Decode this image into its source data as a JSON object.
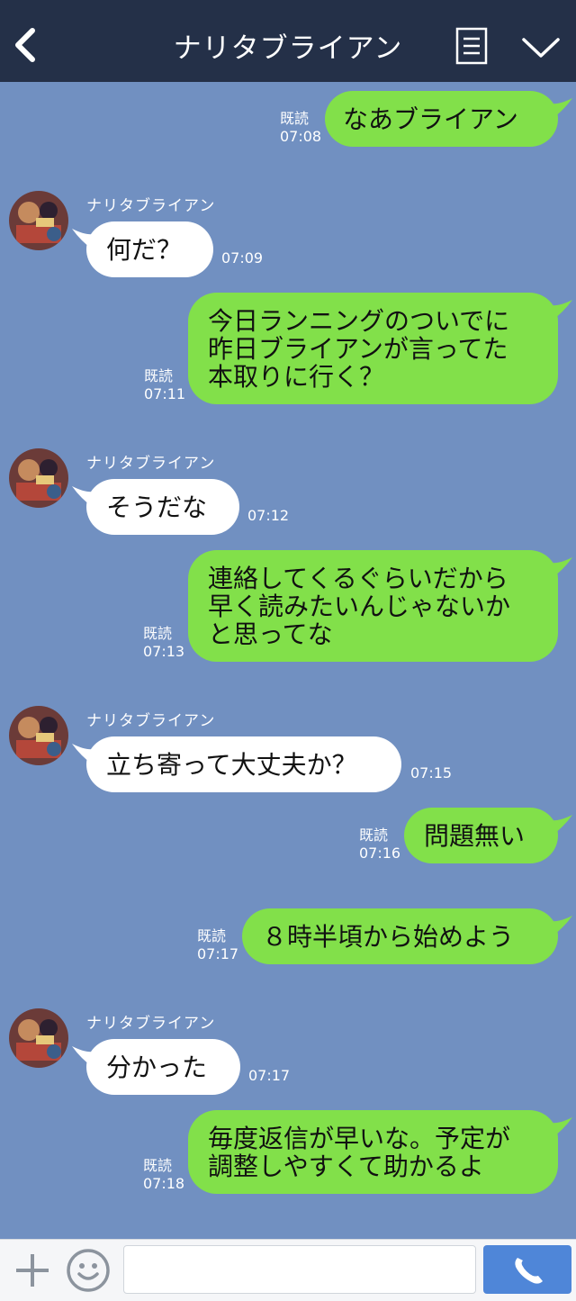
{
  "header": {
    "title": "ナリタブライアン",
    "back_icon": "chevron-left-icon",
    "menu_icon": "list-icon",
    "collapse_icon": "chevron-down-icon"
  },
  "colors": {
    "header_bg": "#243048",
    "chat_bg": "#7190c1",
    "my_bubble": "#82e04a",
    "their_bubble": "#ffffff",
    "send_button": "#4f86d8"
  },
  "messages": [
    {
      "from": "me",
      "lines": [
        "なあブライアン"
      ],
      "read": "既読",
      "time": "07:08"
    },
    {
      "from": "them",
      "sender": "ナリタブライアン",
      "lines": [
        "何だ？"
      ],
      "time": "07:09"
    },
    {
      "from": "me",
      "lines": [
        "今日ランニングのついでに",
        "昨日ブライアンが言ってた",
        "本取りに行く？"
      ],
      "read": "既読",
      "time": "07:11"
    },
    {
      "from": "them",
      "sender": "ナリタブライアン",
      "lines": [
        "そうだな"
      ],
      "time": "07:12"
    },
    {
      "from": "me",
      "lines": [
        "連絡してくるぐらいだから",
        "早く読みたいんじゃないか",
        "と思ってな"
      ],
      "read": "既読",
      "time": "07:13"
    },
    {
      "from": "them",
      "sender": "ナリタブライアン",
      "lines": [
        "立ち寄って大丈夫か？"
      ],
      "time": "07:15"
    },
    {
      "from": "me",
      "lines": [
        "問題無い"
      ],
      "read": "既読",
      "time": "07:16"
    },
    {
      "from": "me",
      "lines": [
        "８時半頃から始めよう"
      ],
      "read": "既読",
      "time": "07:17"
    },
    {
      "from": "them",
      "sender": "ナリタブライアン",
      "lines": [
        "分かった"
      ],
      "time": "07:17"
    },
    {
      "from": "me",
      "lines": [
        "毎度返信が早いな。予定が",
        "調整しやすくて助かるよ"
      ],
      "read": "既読",
      "time": "07:18"
    }
  ],
  "composer": {
    "plus_icon": "plus-icon",
    "emoji_icon": "emoji-icon",
    "input_value": "",
    "send_icon": "phone-icon"
  }
}
